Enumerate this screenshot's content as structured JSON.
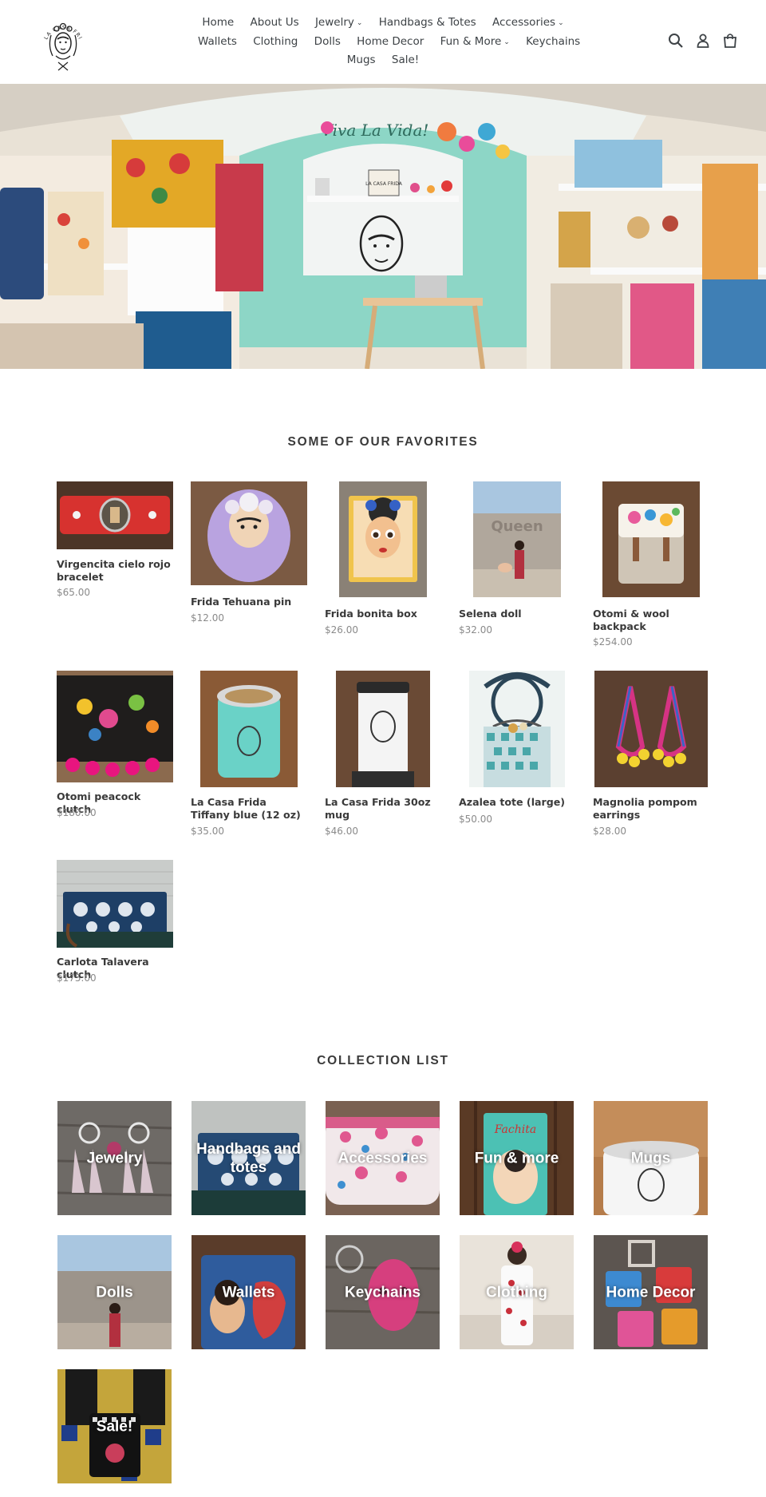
{
  "header": {
    "logo_text": "LA CASA FRIDA",
    "nav_rows": [
      [
        {
          "label": "Home",
          "dropdown": false
        },
        {
          "label": "About Us",
          "dropdown": false
        },
        {
          "label": "Jewelry",
          "dropdown": true
        },
        {
          "label": "Handbags & Totes",
          "dropdown": false
        },
        {
          "label": "Accessories",
          "dropdown": true
        }
      ],
      [
        {
          "label": "Wallets",
          "dropdown": false
        },
        {
          "label": "Clothing",
          "dropdown": false
        },
        {
          "label": "Dolls",
          "dropdown": false
        },
        {
          "label": "Home Decor",
          "dropdown": false
        },
        {
          "label": "Fun & More",
          "dropdown": true
        },
        {
          "label": "Keychains",
          "dropdown": false
        }
      ],
      [
        {
          "label": "Mugs",
          "dropdown": false
        },
        {
          "label": "Sale!",
          "dropdown": false
        }
      ]
    ],
    "icons": [
      "search-icon",
      "account-icon",
      "cart-icon"
    ]
  },
  "hero": {
    "sign_text": "Viva La Vida!",
    "box_text": "LA CASA FRIDA"
  },
  "favorites": {
    "title": "SOME OF OUR FAVORITES",
    "products": [
      {
        "name": "Virgencita cielo rojo bracelet",
        "price": "$65.00"
      },
      {
        "name": "Frida Tehuana pin",
        "price": "$12.00"
      },
      {
        "name": "Frida bonita box",
        "price": "$26.00"
      },
      {
        "name": "Selena doll",
        "price": "$32.00"
      },
      {
        "name": "Otomi & wool backpack",
        "price": "$254.00"
      },
      {
        "name": "Otomi peacock clutch",
        "price": "$180.00"
      },
      {
        "name": "La Casa Frida Tiffany blue (12 oz)",
        "price": "$35.00"
      },
      {
        "name": "La Casa Frida 30oz mug",
        "price": "$46.00"
      },
      {
        "name": "Azalea tote (large)",
        "price": "$50.00"
      },
      {
        "name": "Magnolia pompom earrings",
        "price": "$28.00"
      },
      {
        "name": "Carlota Talavera clutch",
        "price": "$175.00"
      }
    ]
  },
  "collections": {
    "title": "COLLECTION LIST",
    "items": [
      {
        "label": "Jewelry"
      },
      {
        "label": "Handbags and totes"
      },
      {
        "label": "Accessories"
      },
      {
        "label": "Fun & more"
      },
      {
        "label": "Mugs"
      },
      {
        "label": "Dolls"
      },
      {
        "label": "Wallets"
      },
      {
        "label": "Keychains"
      },
      {
        "label": "Clothing"
      },
      {
        "label": "Home Decor"
      },
      {
        "label": "Sale!"
      }
    ]
  }
}
